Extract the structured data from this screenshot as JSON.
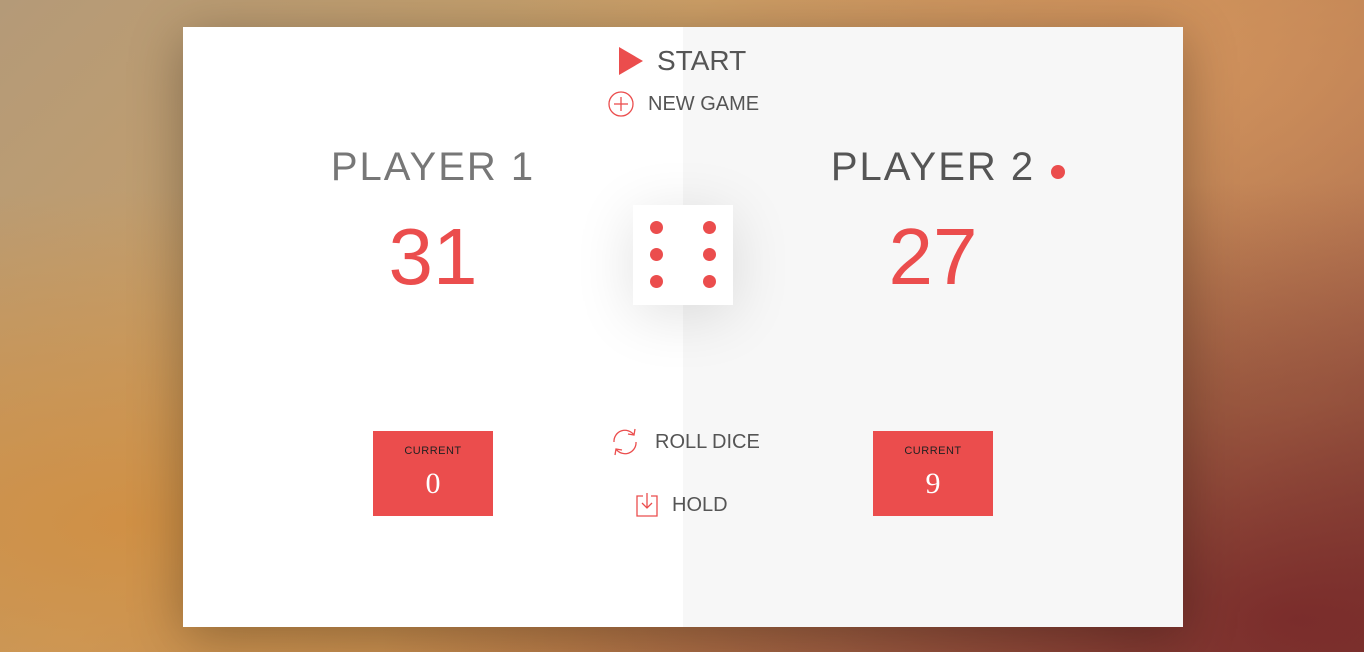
{
  "controls": {
    "start_label": "START",
    "new_game_label": "NEW GAME",
    "roll_dice_label": "ROLL DICE",
    "hold_label": "HOLD"
  },
  "players": [
    {
      "name": "PLAYER 1",
      "score": "31",
      "current_label": "CURRENT",
      "current_score": "0",
      "active": false
    },
    {
      "name": "PLAYER 2",
      "score": "27",
      "current_label": "CURRENT",
      "current_score": "9",
      "active": true
    }
  ],
  "dice": {
    "value": 6
  },
  "colors": {
    "accent": "#EB4D4D",
    "panel_left": "#ffffff",
    "panel_right": "#f7f7f7",
    "text": "#555555"
  },
  "icons": {
    "start": "play-icon",
    "new_game": "plus-circle-icon",
    "roll_dice": "refresh-icon",
    "hold": "download-icon",
    "active_player": "active-dot-icon"
  }
}
